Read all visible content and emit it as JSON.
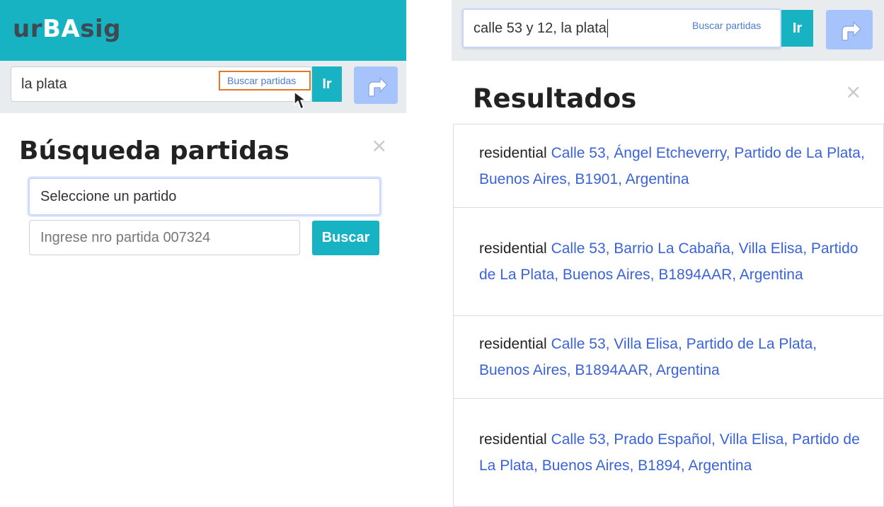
{
  "left": {
    "logo": {
      "part1": "ur",
      "part2": "BA",
      "part3": "sig"
    },
    "search": {
      "value": "la plata",
      "buscar_link": "Buscar partidas",
      "go_label": "Ir"
    },
    "modal": {
      "title": "Búsqueda partidas",
      "close": "×",
      "partido_select": "Seleccione un partido",
      "partida_placeholder": "Ingrese nro partida 007324",
      "buscar_button": "Buscar"
    }
  },
  "right": {
    "search": {
      "value": "calle 53 y 12, la plata",
      "buscar_link": "Buscar partidas",
      "go_label": "Ir"
    },
    "results": {
      "title": "Resultados",
      "close": "×",
      "items": [
        {
          "type": "residential",
          "address": "Calle 53, Ángel Etcheverry, Partido de La Plata, Buenos Aires, B1901, Argentina"
        },
        {
          "type": "residential",
          "address": "Calle 53, Barrio La Cabaña, Villa Elisa, Partido de La Plata, Buenos Aires, B1894AAR, Argentina"
        },
        {
          "type": "residential",
          "address": "Calle 53, Villa Elisa, Partido de La Plata, Buenos Aires, B1894AAR, Argentina"
        },
        {
          "type": "residential",
          "address": "Calle 53, Prado Español, Villa Elisa, Partido de La Plata, Buenos Aires, B1894, Argentina"
        }
      ]
    }
  },
  "colors": {
    "brand": "#17b3c3",
    "route_button": "#a7c3fb",
    "highlight": "#e07a2a",
    "link": "#3b63d8"
  },
  "icons": {
    "route": "turn-right-arrow-icon",
    "cursor": "mouse-pointer-icon",
    "close": "close-icon"
  }
}
